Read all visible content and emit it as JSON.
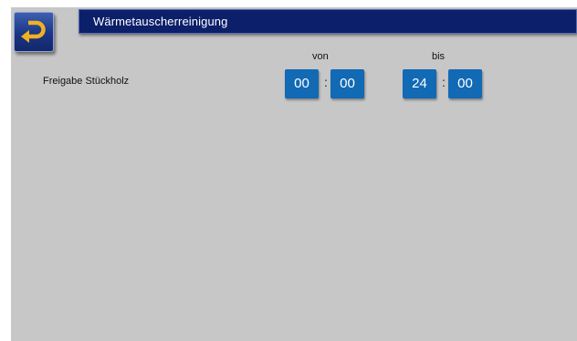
{
  "header": {
    "title": "Wärmetauscherreinigung",
    "back_icon": "return-arrow-icon"
  },
  "columns": {
    "from_label": "von",
    "to_label": "bis"
  },
  "rows": [
    {
      "label": "Freigabe Stückholz",
      "from": {
        "hours": "00",
        "minutes": "00"
      },
      "to": {
        "hours": "24",
        "minutes": "00"
      },
      "separator": ":"
    }
  ],
  "colors": {
    "title_bar": "#0c1f6a",
    "time_box": "#1269b4",
    "background": "#c7c7c7",
    "back_arrow": "#f0b020"
  }
}
